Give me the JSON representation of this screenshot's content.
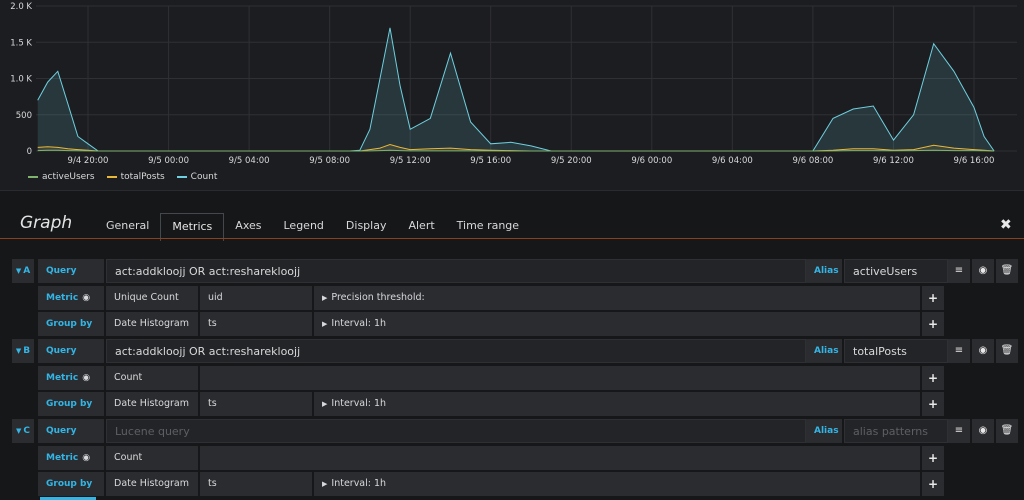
{
  "chart_data": {
    "type": "area",
    "x": [
      "9/4 17:30",
      "9/4 18:00",
      "9/4 18:30",
      "9/4 19:00",
      "9/4 19:30",
      "9/4 20:00",
      "9/4 20:30",
      "9/4 21:00",
      "9/5 08:00",
      "9/5 09:00",
      "9/5 09:30",
      "9/5 10:00",
      "9/5 10:30",
      "9/5 11:00",
      "9/5 11:30",
      "9/5 12:00",
      "9/5 13:00",
      "9/5 14:00",
      "9/5 15:00",
      "9/5 16:00",
      "9/5 17:00",
      "9/5 18:00",
      "9/5 19:00",
      "9/6 08:00",
      "9/6 09:00",
      "9/6 10:00",
      "9/6 11:00",
      "9/6 12:00",
      "9/6 13:00",
      "9/6 14:00",
      "9/6 15:00",
      "9/6 16:00",
      "9/6 16:30",
      "9/6 17:00"
    ],
    "series": [
      {
        "name": "activeUsers",
        "color": "#7eb26d",
        "values": [
          5,
          10,
          10,
          5,
          3,
          2,
          0,
          0,
          0,
          0,
          0,
          2,
          5,
          10,
          5,
          2,
          2,
          2,
          2,
          2,
          0,
          0,
          0,
          0,
          2,
          5,
          5,
          3,
          5,
          10,
          5,
          5,
          3,
          0
        ]
      },
      {
        "name": "totalPosts",
        "color": "#eab839",
        "values": [
          50,
          60,
          50,
          30,
          20,
          10,
          0,
          0,
          0,
          0,
          0,
          20,
          40,
          90,
          50,
          20,
          30,
          40,
          20,
          10,
          5,
          0,
          0,
          0,
          10,
          30,
          30,
          10,
          20,
          80,
          40,
          20,
          10,
          0
        ]
      },
      {
        "name": "Count",
        "color": "#6ed0e0",
        "values": [
          700,
          950,
          1100,
          650,
          200,
          100,
          0,
          0,
          0,
          0,
          10,
          300,
          1000,
          1700,
          900,
          300,
          450,
          1350,
          400,
          100,
          120,
          70,
          0,
          0,
          450,
          580,
          620,
          150,
          500,
          1480,
          1100,
          600,
          200,
          0
        ]
      }
    ],
    "y_ticks": [
      "2.0 K",
      "1.5 K",
      "1.0 K",
      "500",
      "0"
    ],
    "x_ticks": [
      "9/4 20:00",
      "9/5 00:00",
      "9/5 04:00",
      "9/5 08:00",
      "9/5 12:00",
      "9/5 16:00",
      "9/5 20:00",
      "9/6 00:00",
      "9/6 04:00",
      "9/6 08:00",
      "9/6 12:00",
      "9/6 16:00"
    ],
    "ylim": [
      0,
      2000
    ],
    "legend": "bottom-left",
    "grid": true
  },
  "editor": {
    "title": "Graph",
    "tabs": [
      "General",
      "Metrics",
      "Axes",
      "Legend",
      "Display",
      "Alert",
      "Time range"
    ],
    "active_tab": "Metrics",
    "close_glyph": "✖"
  },
  "labels": {
    "query": "Query",
    "alias": "Alias",
    "metric": "Metric",
    "group_by": "Group by",
    "plus": "+"
  },
  "queries": [
    {
      "ref": "A",
      "query": "act:addkloojj OR act:resharekloojj",
      "query_placeholder": "",
      "alias": "activeUsers",
      "alias_placeholder": "",
      "metric_type": "Unique Count",
      "metric_field": "uid",
      "metric_option": "Precision threshold:",
      "group_type": "Date Histogram",
      "group_field": "ts",
      "group_option": "Interval: 1h"
    },
    {
      "ref": "B",
      "query": "act:addkloojj OR act:resharekloojj",
      "query_placeholder": "",
      "alias": "totalPosts",
      "alias_placeholder": "",
      "metric_type": "Count",
      "metric_field": "",
      "metric_option": "",
      "group_type": "Date Histogram",
      "group_field": "ts",
      "group_option": "Interval: 1h"
    },
    {
      "ref": "C",
      "query": "",
      "query_placeholder": "Lucene query",
      "alias": "",
      "alias_placeholder": "alias patterns",
      "metric_type": "Count",
      "metric_field": "",
      "metric_option": "",
      "group_type": "Date Histogram",
      "group_field": "ts",
      "group_option": "Interval: 1h"
    }
  ],
  "icons": {
    "menu": "≡",
    "eye": "◉",
    "trash": "🗑",
    "caret_down": "▼",
    "caret_right": "▶"
  }
}
